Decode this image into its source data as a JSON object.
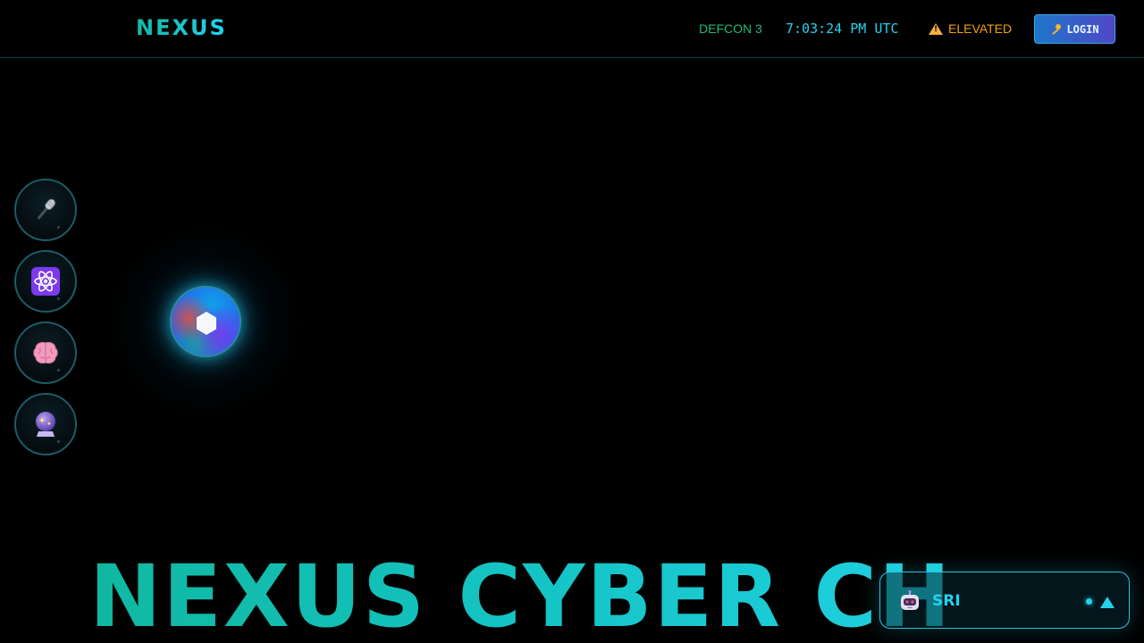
{
  "header": {
    "logo": "NEXUS",
    "defcon": "DEFCON 3",
    "clock": "7:03:24 PM UTC",
    "threat_level": "ELEVATED",
    "login_label": "LOGIN",
    "login_icon": "key-icon",
    "threat_icon": "warning-icon"
  },
  "sidebar": {
    "items": [
      {
        "icon": "microphone-icon"
      },
      {
        "icon": "atom-icon"
      },
      {
        "icon": "brain-icon"
      },
      {
        "icon": "crystal-ball-icon"
      }
    ]
  },
  "orb": {
    "icon": "hexagon-icon"
  },
  "hero": {
    "title": "NEXUS CYBER CH"
  },
  "chat": {
    "name": "SRI",
    "icon": "robot-icon",
    "status": "online",
    "expand_icon": "chevron-up-icon"
  },
  "colors": {
    "accent_teal": "#14b8a6",
    "accent_cyan": "#22d3ee",
    "defcon_green": "#1fb87a",
    "warning_amber": "#f59e0b",
    "login_gradient_start": "#1d77c9",
    "login_gradient_end": "#4f46c8",
    "background": "#000000"
  }
}
